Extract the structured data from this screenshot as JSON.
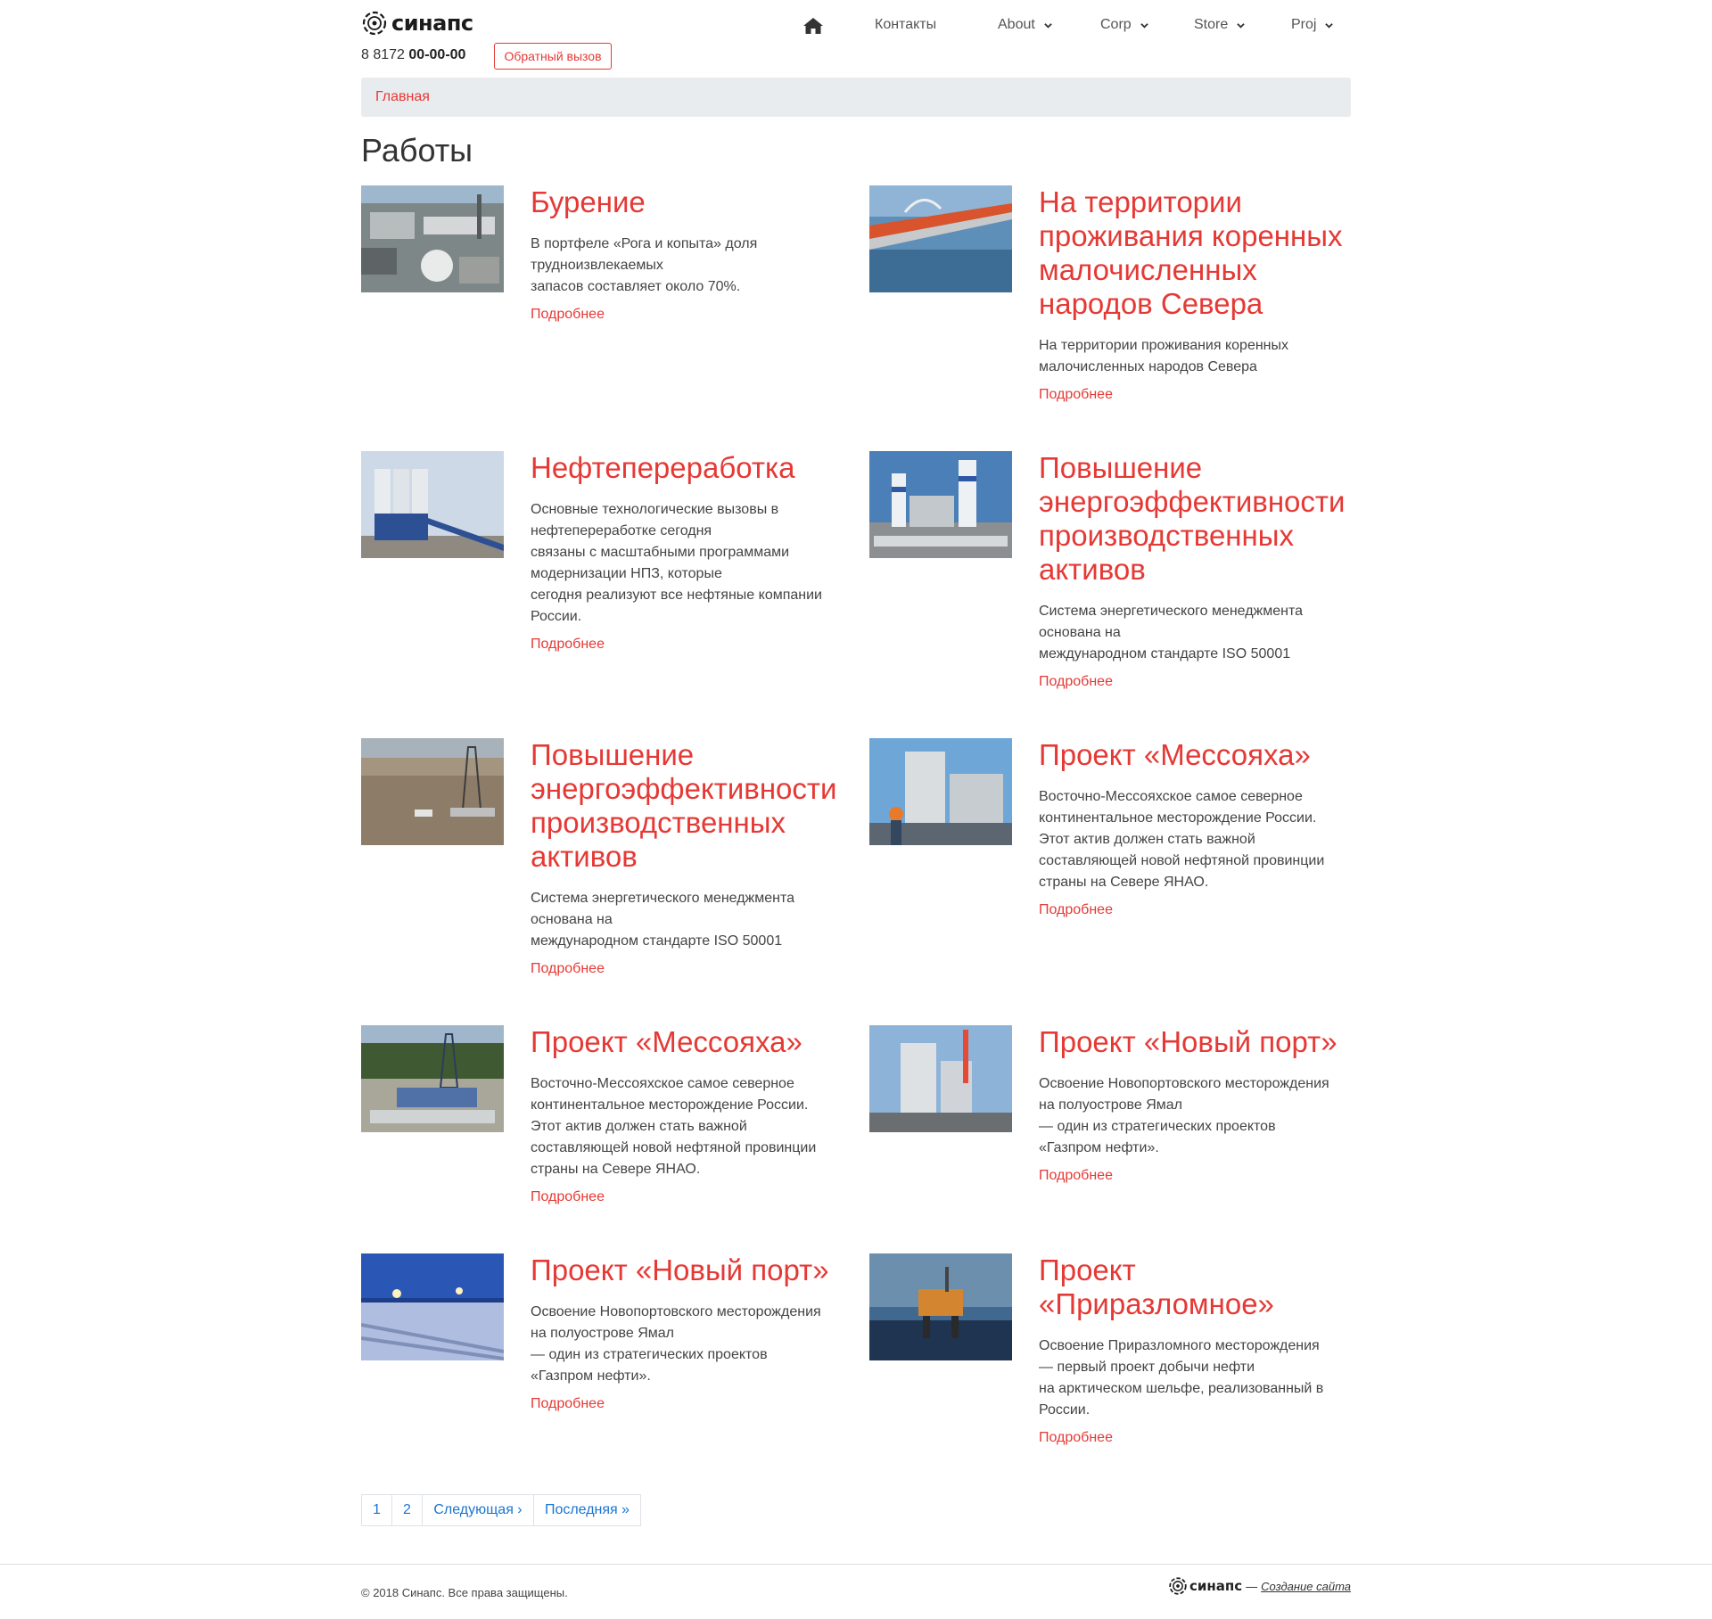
{
  "header": {
    "logo_text": "синапс",
    "phone_prefix": "8 8172",
    "phone_number": "00-00-00",
    "callback_label": "Обратный вызов",
    "nav": [
      {
        "label": "Контакты",
        "has_dropdown": false
      },
      {
        "label": "About",
        "has_dropdown": true
      },
      {
        "label": "Corp",
        "has_dropdown": true
      },
      {
        "label": "Store",
        "has_dropdown": true
      },
      {
        "label": "Proj",
        "has_dropdown": true
      }
    ]
  },
  "breadcrumb": {
    "home_label": "Главная"
  },
  "page_title": "Работы",
  "items": [
    {
      "title": "Бурение",
      "desc": [
        "В портфеле «Рога и копыта» доля",
        "трудноизвлекаемых",
        "запасов составляет около 70%."
      ],
      "more": "Подробнее",
      "image": "industrial-plant-aerial"
    },
    {
      "title": "На территории проживания коренных малочисленных народов Севера",
      "desc": [
        "На территории проживания коренных",
        "малочисленных народов Севера"
      ],
      "more": "Подробнее",
      "image": "bridge-over-sea"
    },
    {
      "title": "Нефтепереработка",
      "desc": [
        "Основные технологические вызовы в",
        "нефтепереработке сегодня",
        "связаны с масштабными программами",
        "модернизации НПЗ, которые",
        "сегодня реализуют все нефтяные компании",
        "России."
      ],
      "more": "Подробнее",
      "image": "concrete-silos"
    },
    {
      "title": "Повышение энергоэффективности производственных активов",
      "desc": [
        "Система энергетического менеджмента",
        "основана на",
        "международном стандарте ISO 50001"
      ],
      "more": "Подробнее",
      "image": "silo-plant-trucks"
    },
    {
      "title": "Повышение энергоэффективности производственных активов",
      "desc": [
        "Система энергетического менеджмента",
        "основана на",
        "международном стандарте ISO 50001"
      ],
      "more": "Подробнее",
      "image": "drilling-rig-desert"
    },
    {
      "title": "Проект «Мессояха»",
      "desc": [
        "Восточно-Мессояхское самое северное",
        "континентальное месторождение России.",
        "Этот актив должен стать важной",
        "составляющей новой нефтяной провинции",
        "страны на Севере ЯНАО."
      ],
      "more": "Подробнее",
      "image": "power-plant-worker"
    },
    {
      "title": "Проект «Мессояха»",
      "desc": [
        "Восточно-Мессояхское самое северное",
        "континентальное месторождение России.",
        "Этот актив должен стать важной",
        "составляющей новой нефтяной провинции",
        "страны на Севере ЯНАО."
      ],
      "more": "Подробнее",
      "image": "drilling-site-forest"
    },
    {
      "title": "Проект «Новый порт»",
      "desc": [
        "Освоение Новопортовского месторождения",
        "на полуострове Ямал",
        "— один из стратегических проектов",
        "«Газпром нефти»."
      ],
      "more": "Подробнее",
      "image": "power-plant-chimney"
    },
    {
      "title": "Проект «Новый порт»",
      "desc": [
        "Освоение Новопортовского месторождения",
        "на полуострове Ямал",
        "— один из стратегических проектов",
        "«Газпром нефти»."
      ],
      "more": "Подробнее",
      "image": "pipeline-night"
    },
    {
      "title": "Проект «Приразломное»",
      "desc": [
        "Освоение Приразломного месторождения",
        "— первый проект добычи нефти",
        "на арктическом шельфе, реализованный в",
        "России."
      ],
      "more": "Подробнее",
      "image": "offshore-platform"
    }
  ],
  "pagination": [
    "1",
    "2",
    "Следующая ›",
    "Последняя »"
  ],
  "footer": {
    "copyright": "© 2018 Синапс. Все права защищены.",
    "logo_text": "синапс",
    "dash": "—",
    "credit": "Создание сайта"
  },
  "colors": {
    "accent": "#e53935",
    "link": "#1976d2",
    "breadcrumb_bg": "#e9ecef"
  }
}
